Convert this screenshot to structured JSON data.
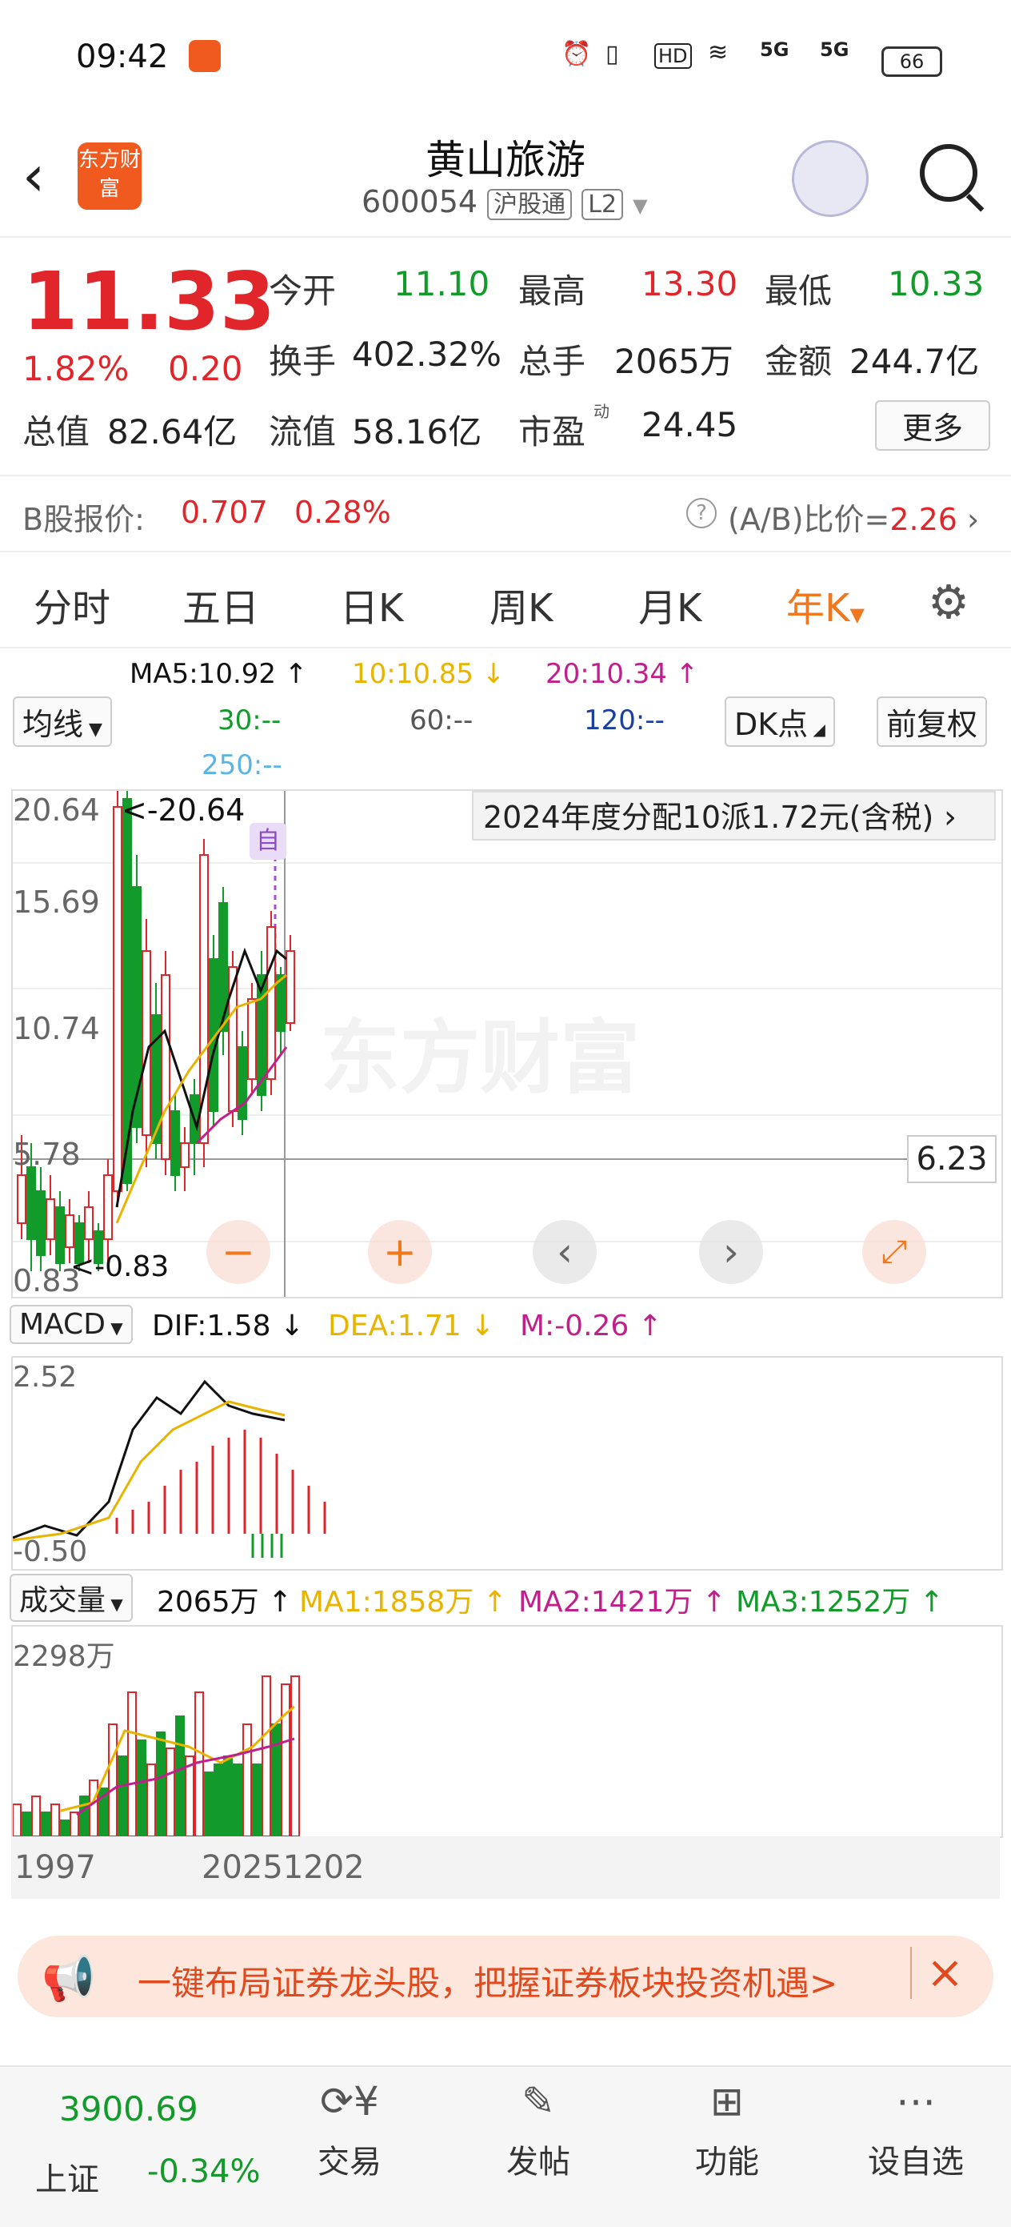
{
  "status": {
    "time": "09:42",
    "battery": "66",
    "net1": "5G",
    "net2": "5G",
    "hd": "HD"
  },
  "header": {
    "logo": "东方财富",
    "title": "黄山旅游",
    "code": "600054",
    "tag1": "沪股通",
    "tag2": "L2"
  },
  "quote": {
    "price": "11.33",
    "pct": "1.82%",
    "chg": "0.20",
    "open_label": "今开",
    "open": "11.10",
    "high_label": "最高",
    "high": "13.30",
    "low_label": "最低",
    "low": "10.33",
    "turnover_label": "换手",
    "turnover": "402.32%",
    "vol_label": "总手",
    "vol": "2065万",
    "amount_label": "金额",
    "amount": "244.7亿",
    "mcap_label": "总值",
    "mcap": "82.64亿",
    "float_label": "流值",
    "float": "58.16亿",
    "pe_label": "市盈",
    "pe_sup": "动",
    "pe": "24.45",
    "more": "更多"
  },
  "bshare": {
    "label": "B股报价:",
    "price": "0.707",
    "pct": "0.28%",
    "ratio_label": "(A/B)比价=",
    "ratio": "2.26"
  },
  "tabs": [
    "分时",
    "五日",
    "日K",
    "周K",
    "月K",
    "年K"
  ],
  "ma": {
    "mode": "均线",
    "ma5": "MA5:10.92",
    "ma10": "10:10.85",
    "ma20": "20:10.34",
    "ma30": "30:--",
    "ma60": "60:--",
    "ma120": "120:--",
    "ma250": "250:--",
    "dk": "DK点",
    "fq": "前复权"
  },
  "kchart": {
    "y_labels": [
      "20.64",
      "15.69",
      "10.74",
      "5.78",
      "0.83"
    ],
    "max_note": "<-20.64",
    "min_note": "<-0.83",
    "dividend": "2024年度分配10派1.72元(含税)",
    "auto": "自",
    "cursor_price": "6.23",
    "watermark": "东方财富"
  },
  "macd": {
    "mode": "MACD",
    "dif": "DIF:1.58",
    "dea": "DEA:1.71",
    "m": "M:-0.26",
    "top": "2.52",
    "bottom": "-0.50"
  },
  "volume": {
    "mode": "成交量",
    "vol": "2065万",
    "ma1": "MA1:1858万",
    "ma2": "MA2:1421万",
    "ma3": "MA3:1252万",
    "top": "2298万"
  },
  "xaxis": {
    "start": "1997",
    "cursor": "20251202"
  },
  "banner": {
    "text": "一键布局证券龙头股，把握证券板块投资机遇>"
  },
  "bottomnav": {
    "index_value": "3900.69",
    "index_name": "上证",
    "index_pct": "-0.34%",
    "items": [
      "交易",
      "发帖",
      "功能",
      "设自选"
    ]
  },
  "colors": {
    "up": "#e0262b",
    "down": "#129b2a",
    "accent": "#f0781e",
    "ma5": "#111111",
    "ma10": "#e8b400",
    "ma20": "#c0208c"
  }
}
